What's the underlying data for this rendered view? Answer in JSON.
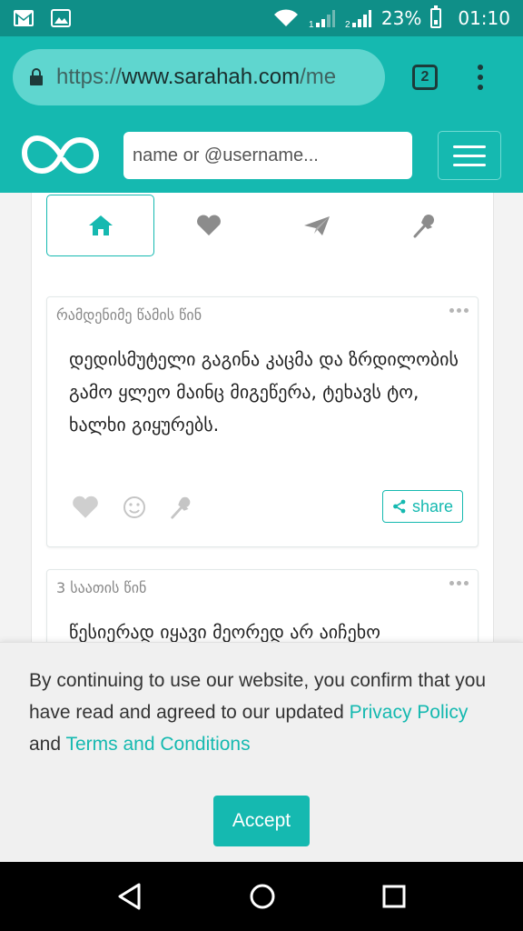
{
  "status_bar": {
    "icons": [
      "gmail-icon",
      "gallery-icon",
      "wifi-icon",
      "signal-sim1-icon",
      "signal-sim2-icon",
      "battery-icon"
    ],
    "sim1_label": "1",
    "sim2_label": "2",
    "battery": "23%",
    "time": "01:10"
  },
  "browser": {
    "url_scheme": "https://",
    "url_host": "www.sarahah.com",
    "url_path": "/me",
    "tab_count": "2"
  },
  "header": {
    "search_placeholder": "name or @username..."
  },
  "nav_tabs": [
    {
      "name": "home",
      "icon": "home-icon",
      "active": true
    },
    {
      "name": "favorites",
      "icon": "heart-icon",
      "active": false
    },
    {
      "name": "sent",
      "icon": "paper-plane-icon",
      "active": false
    },
    {
      "name": "pinned",
      "icon": "pin-icon",
      "active": false
    }
  ],
  "messages": [
    {
      "time": "რამდენიმე წამის წინ",
      "text": "დედისმუტელი გაგინა კაცმა და ზრდილობის გამო ყლეო მაინც მიგეწერა, ტეხავს ტო, ხალხი გიყურებს."
    },
    {
      "time": "3 საათის წინ",
      "text": "წესიერად იყავი მეორედ არ აიჩეხო"
    }
  ],
  "message_actions": {
    "share_label": "share"
  },
  "cookie_banner": {
    "text_before": "By continuing to use our website, you confirm that you have read and agreed to our updated ",
    "privacy_link": "Privacy Policy",
    "text_middle": " and ",
    "terms_link": "Terms and Conditions",
    "accept_label": "Accept"
  },
  "colors": {
    "brand": "#15b9b0",
    "status_bar": "#0f8f88"
  }
}
